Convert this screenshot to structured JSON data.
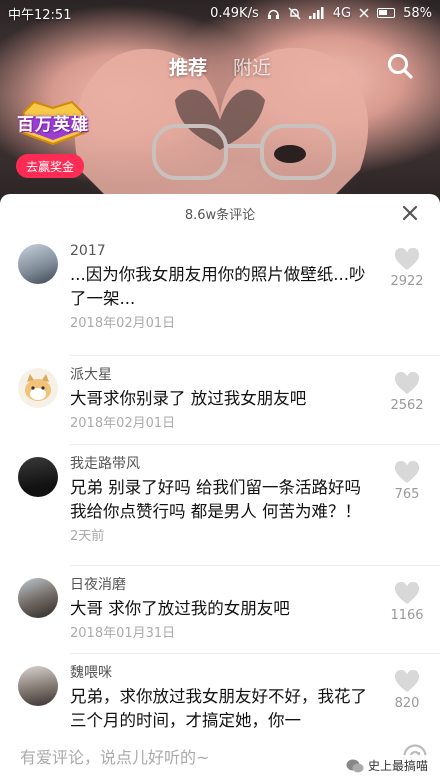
{
  "status_bar": {
    "time": "中午12:51",
    "speed": "0.49K/s",
    "network": "4G",
    "battery": "58%"
  },
  "nav": {
    "tab_recommend": "推荐",
    "tab_nearby": "附近",
    "search_icon": "search-icon"
  },
  "promo": {
    "logo_text": "百万英雄",
    "reward_button": "去赢奖金"
  },
  "comments_panel": {
    "title": "8.6w条评论",
    "close_icon": "close-icon",
    "items": [
      {
        "username": "2017",
        "text": "...因为你我女朋友用你的照片做壁纸...吵了一架...",
        "date": "2018年02月01日",
        "likes": "2922"
      },
      {
        "username": "派大星",
        "text": "大哥求你别录了 放过我女朋友吧",
        "date": "2018年02月01日",
        "likes": "2562"
      },
      {
        "username": "我走路带风",
        "text": "兄弟 别录了好吗 给我们留一条活路好吗 我给你点赞行吗 都是男人 何苦为难？！",
        "date": "2天前",
        "likes": "765"
      },
      {
        "username": "日夜消磨",
        "text": "大哥 求你了放过我的女朋友吧",
        "date": "2018年01月31日",
        "likes": "1166"
      },
      {
        "username": "魏喂咪",
        "text": "兄弟，求你放过我女朋友好不好，我花了三个月的时间，才搞定她，你一",
        "date": "",
        "likes": "820"
      }
    ]
  },
  "input": {
    "placeholder": "有爱评论，说点儿好听的~",
    "at_icon": "at-icon"
  },
  "watermark": {
    "text": "史上最搞喵"
  },
  "colors": {
    "accent": "#fe2c55",
    "like_gray": "#d8d8d8"
  }
}
